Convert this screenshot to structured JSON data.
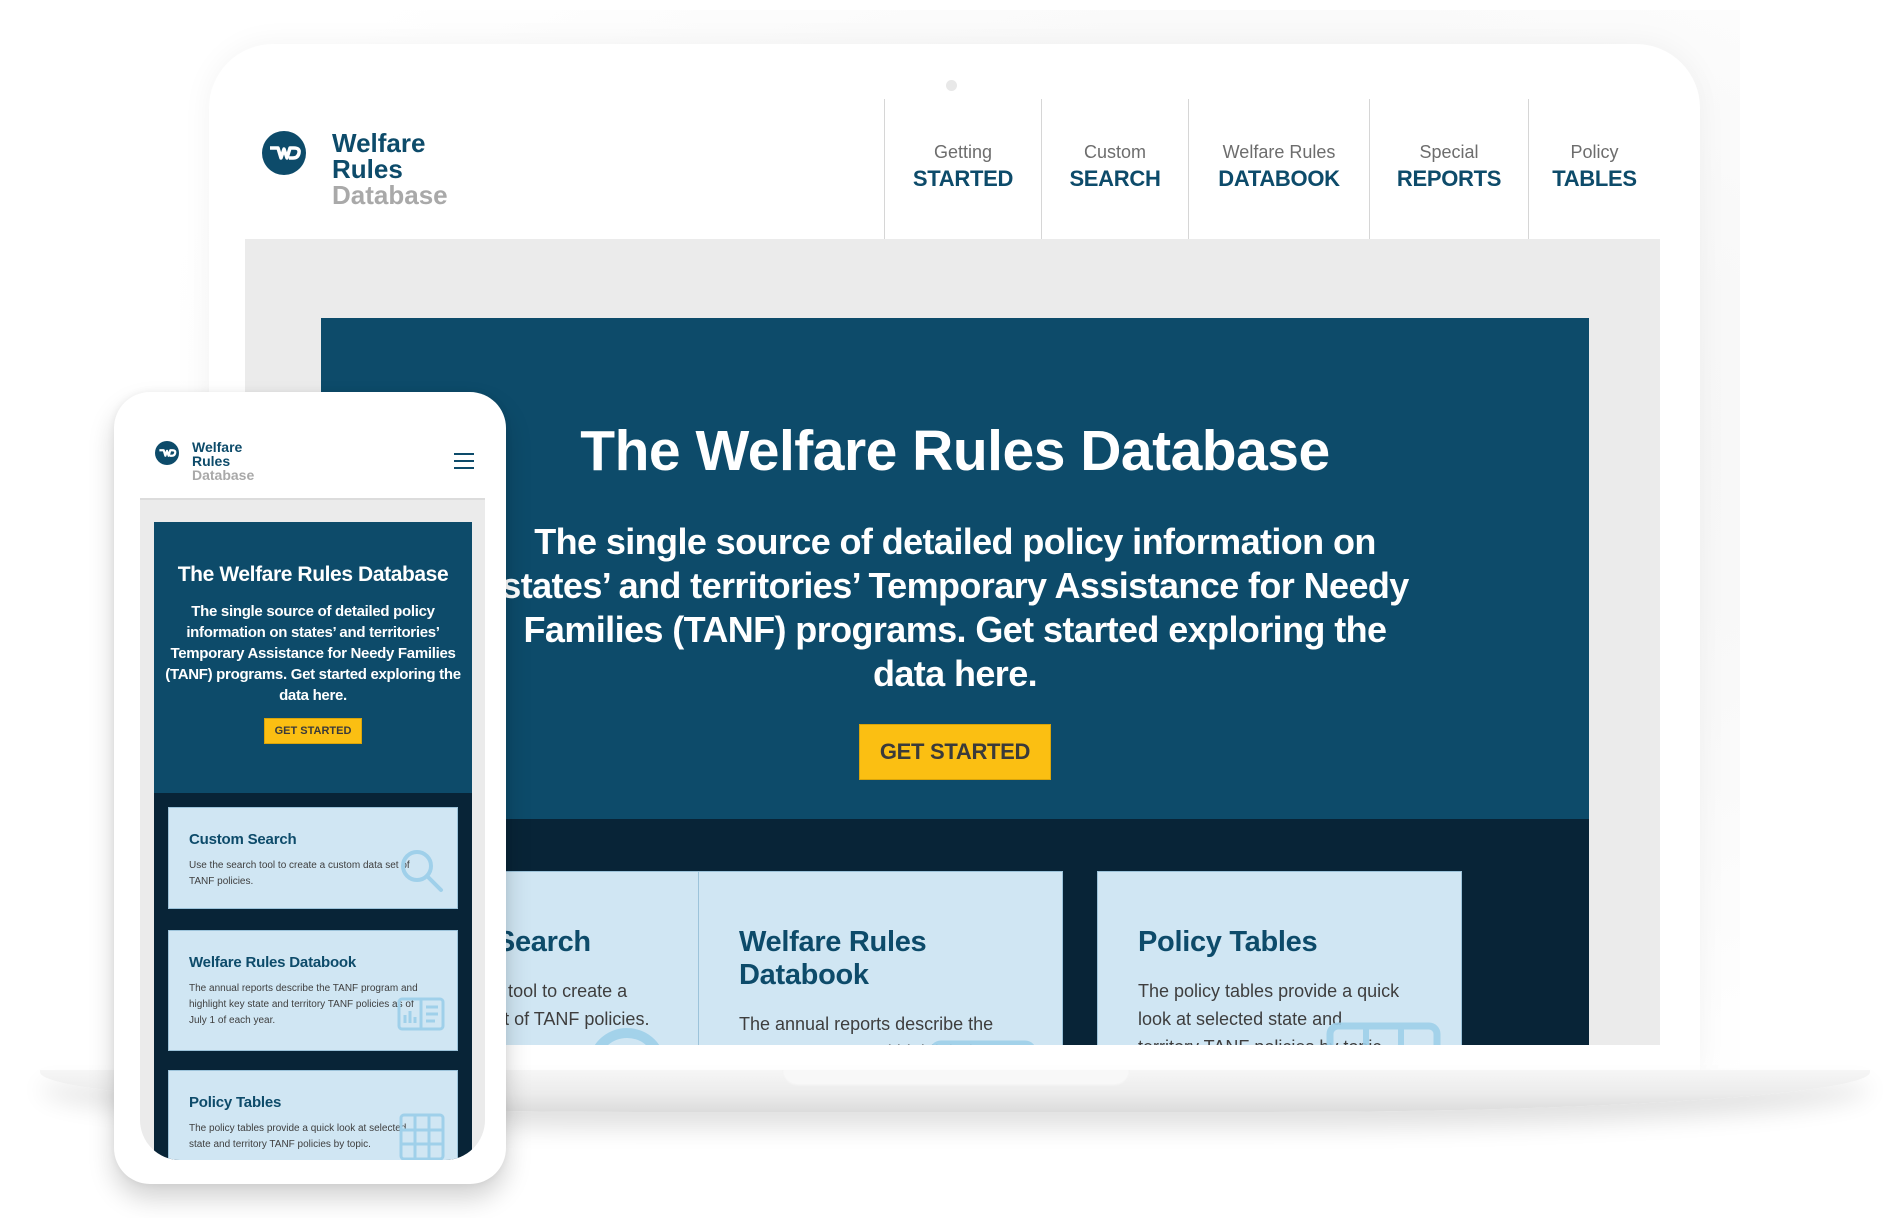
{
  "brand": {
    "line1": "Welfare",
    "line2": "Rules",
    "line3": "Database"
  },
  "desktop": {
    "nav": [
      {
        "top": "Getting",
        "bottom": "STARTED"
      },
      {
        "top": "Custom",
        "bottom": "SEARCH"
      },
      {
        "top": "Welfare Rules",
        "bottom": "DATABOOK"
      },
      {
        "top": "Special",
        "bottom": "REPORTS"
      },
      {
        "top": "Policy",
        "bottom": "TABLES"
      }
    ],
    "hero": {
      "title": "The Welfare Rules Database",
      "subtitle": "The single source of detailed policy information on states’ and territories’ Temporary Assistance for Needy Families (TANF) programs. Get started exploring the data here.",
      "cta": "GET STARTED"
    },
    "cards": [
      {
        "title": "Custom Search",
        "text": "Use the search tool to create a custom data set of TANF policies.",
        "icon": "magnifier-icon"
      },
      {
        "title": "Welfare Rules Databook",
        "text": "The annual reports describe the TANF program and highlight key state and territory TANF policies as of July 1 of each year.",
        "icon": "report-icon"
      },
      {
        "title": "Policy Tables",
        "text": "The policy tables provide a quick look at selected state and territory TANF policies by topic.",
        "icon": "table-grid-icon"
      }
    ]
  },
  "mobile": {
    "menu_icon": "hamburger-icon",
    "hero": {
      "title": "The Welfare Rules Database",
      "subtitle": "The single source of detailed policy information on states’ and territories’ Temporary Assistance for Needy Families (TANF) programs. Get started exploring the data here.",
      "cta": "GET STARTED"
    },
    "cards": [
      {
        "title": "Custom Search",
        "text": "Use the search tool to create a custom data set of TANF policies.",
        "icon": "magnifier-icon"
      },
      {
        "title": "Welfare Rules Databook",
        "text": "The annual reports describe the TANF program and highlight key state and territory TANF policies as of July 1 of each year.",
        "icon": "report-icon"
      },
      {
        "title": "Policy Tables",
        "text": "The policy tables provide a quick look at selected state and territory TANF policies by topic.",
        "icon": "table-grid-icon"
      }
    ]
  },
  "colors": {
    "brand_navy": "#0d4b6a",
    "dark_band": "#082437",
    "card_bg": "#d0e6f3",
    "cta_yellow": "#fbbf12",
    "page_gray": "#ebebeb",
    "logo_gray": "#a9a9a9"
  }
}
